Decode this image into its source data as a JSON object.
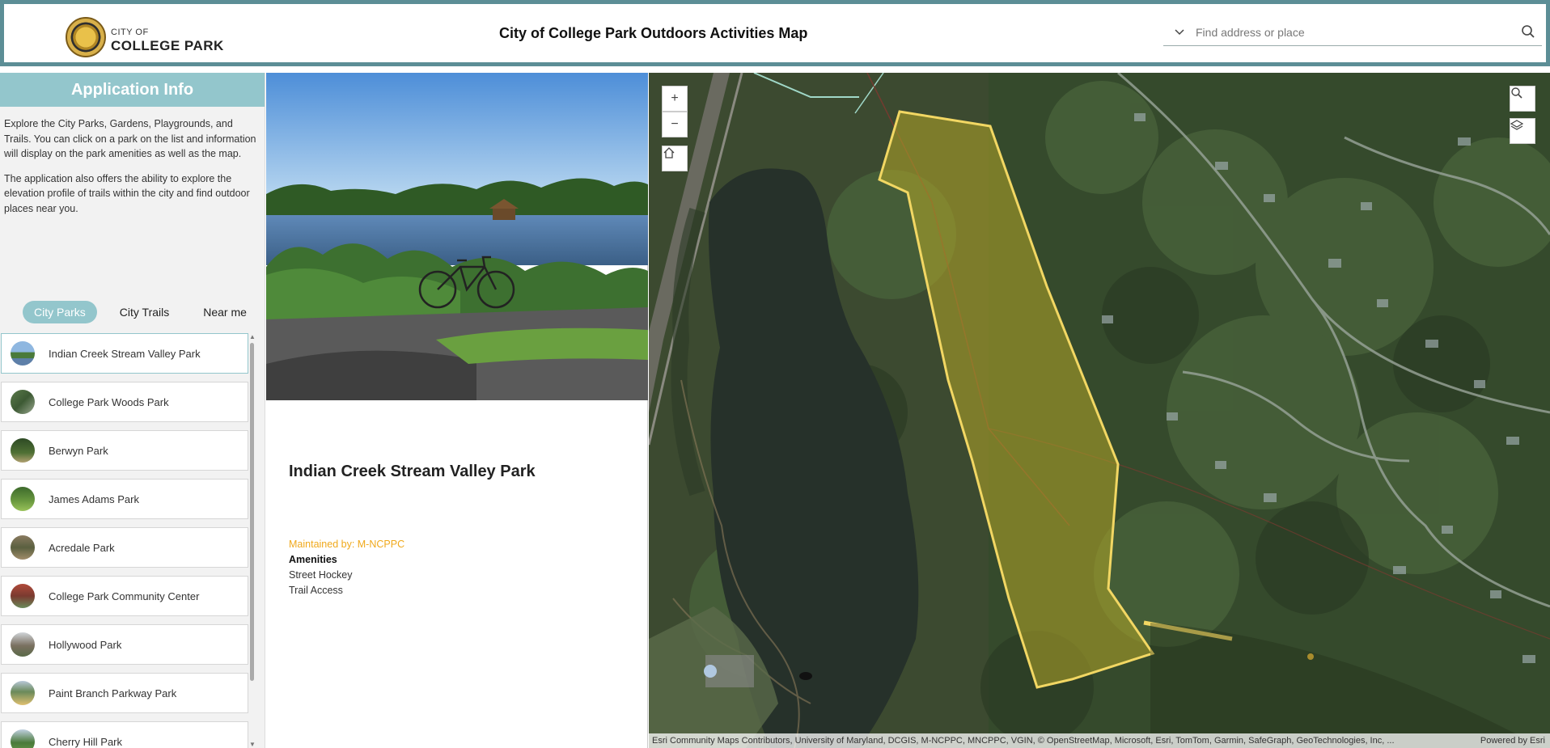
{
  "header": {
    "brand_small": "CITY OF",
    "brand_big": "COLLEGE PARK",
    "title": "City of College Park Outdoors Activities Map",
    "search_placeholder": "Find address or place"
  },
  "sidebar": {
    "heading": "Application Info",
    "desc1": "Explore the City Parks, Gardens, Playgrounds, and Trails. You can click on a park on the list and information will display on the park amenities as well as the map.",
    "desc2": "The application also offers the ability to explore the elevation profile of trails within the city and find outdoor places near you.",
    "tabs": [
      {
        "label": "City Parks",
        "active": true
      },
      {
        "label": "City Trails",
        "active": false
      },
      {
        "label": "Near me",
        "active": false
      }
    ],
    "parks": [
      "Indian Creek Stream Valley Park",
      "College Park Woods Park",
      "Berwyn Park",
      "James Adams Park",
      "Acredale Park",
      "College Park Community Center",
      "Hollywood Park",
      "Paint Branch Parkway Park",
      "Cherry Hill Park"
    ]
  },
  "detail": {
    "park_name": "Indian Creek Stream Valley Park",
    "maintained": "Maintained by: M-NCPPC",
    "amenities_label": "Amenities",
    "amenities": [
      "Street Hockey",
      "Trail Access"
    ]
  },
  "map": {
    "zoom_in": "+",
    "zoom_out": "−",
    "attribution": "Esri Community Maps Contributors, University of Maryland, DCGIS, M-NCPPC, MNCPPC, VGIN, © OpenStreetMap, Microsoft, Esri, TomTom, Garmin, SafeGraph, GeoTechnologies, Inc, ...",
    "powered": "Powered by Esri"
  },
  "colors": {
    "accent": "#93c6cc",
    "header_border": "#5c8e96",
    "maintained_text": "#f0a91c",
    "park_outline": "#f2d763"
  }
}
